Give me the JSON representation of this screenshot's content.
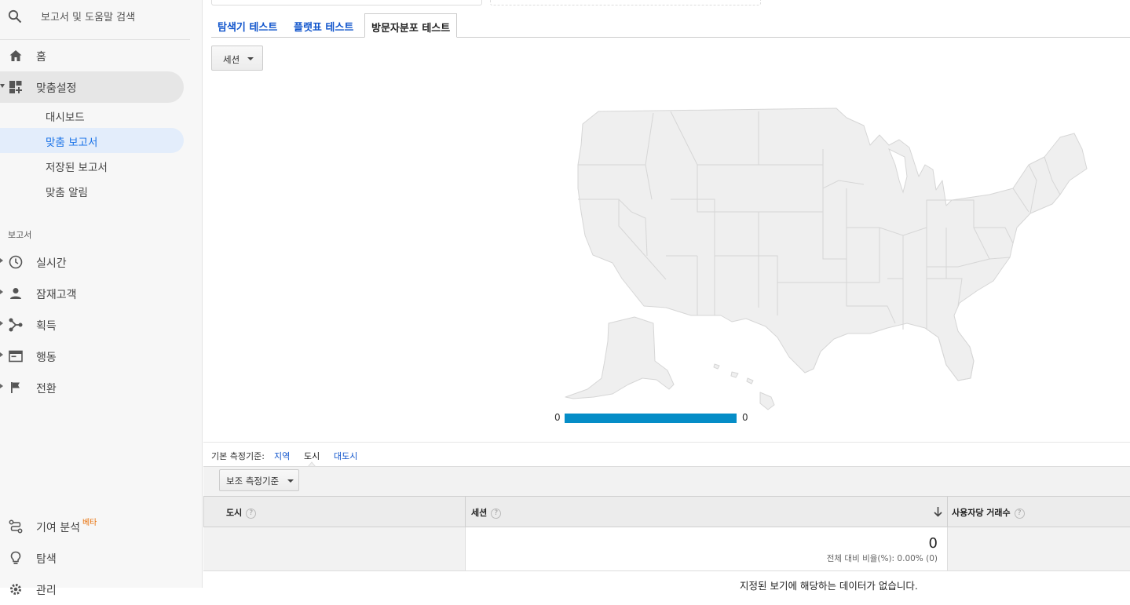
{
  "sidebar": {
    "search_placeholder": "보고서 및 도움말 검색",
    "home_label": "홈",
    "customization_label": "맞춤설정",
    "sub_items": [
      "대시보드",
      "맞춤 보고서",
      "저장된 보고서",
      "맞춤 알림"
    ],
    "reports_section": "보고서",
    "report_items": [
      "실시간",
      "잠재고객",
      "획득",
      "행동",
      "전환"
    ],
    "attribution_label": "기여 분석",
    "beta_label": "베타",
    "discover_label": "탐색",
    "admin_label": "관리"
  },
  "tabs": [
    "탐색기 테스트",
    "플랫표 테스트",
    "방문자분포 테스트"
  ],
  "active_tab_index": 2,
  "metric_dropdown": "세션",
  "map": {
    "region": "United States",
    "legend_min": "0",
    "legend_max": "0",
    "fill_color": "#efefef",
    "stroke_color": "#d8d8d8",
    "legend_color": "#058dc7"
  },
  "dimension": {
    "label": "기본 측정기준:",
    "options": [
      "지역",
      "도시",
      "대도시"
    ],
    "active_index": 1
  },
  "secondary_dimension": "보조 측정기준",
  "table": {
    "columns": [
      "도시",
      "세션",
      "사용자당 거래수"
    ],
    "sort_column_index": 1,
    "total_value": "0",
    "total_pct": "전체 대비 비율(%): 0.00% (0)",
    "no_data": "지정된 보기에 해당하는 데이터가 없습니다."
  }
}
